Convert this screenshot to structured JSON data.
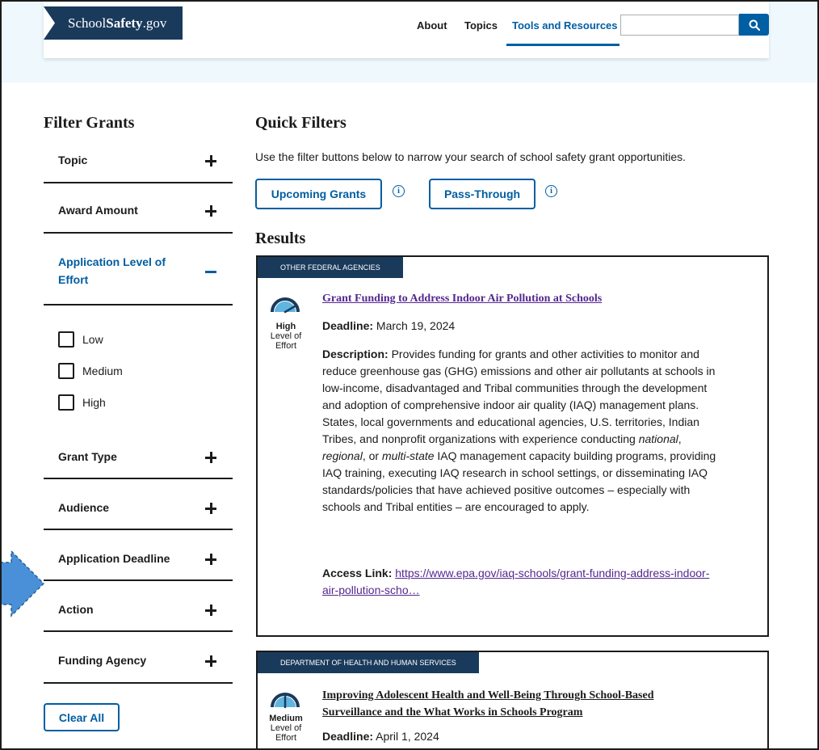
{
  "header": {
    "logo_regular": "School",
    "logo_bold": "Safety",
    "logo_suffix": ".gov",
    "nav": [
      {
        "label": "About"
      },
      {
        "label": "Topics"
      },
      {
        "label": "Tools and Resources"
      }
    ],
    "search_placeholder": ""
  },
  "sidebar": {
    "title": "Filter Grants",
    "items": [
      {
        "label": "Topic"
      },
      {
        "label": "Award Amount"
      },
      {
        "label": "Application Level of Effort"
      },
      {
        "label": "Grant Type"
      },
      {
        "label": "Audience"
      },
      {
        "label": "Application Deadline"
      },
      {
        "label": "Action"
      },
      {
        "label": "Funding Agency"
      }
    ],
    "effort_options": [
      {
        "label": "Low",
        "checked": false
      },
      {
        "label": "Medium",
        "checked": false
      },
      {
        "label": "High",
        "checked": false
      }
    ],
    "clear_label": "Clear All"
  },
  "main": {
    "quick_title": "Quick Filters",
    "intro": "Use the filter buttons below to narrow your search of school safety grant opportunities.",
    "quick_buttons": [
      {
        "label": "Upcoming Grants"
      },
      {
        "label": "Pass-Through"
      }
    ],
    "info_glyph": "i",
    "results_title": "Results",
    "results": [
      {
        "agency": "Other Federal Agencies",
        "effort_level": "High",
        "effort_caption_1": "Level of",
        "effort_caption_2": "Effort",
        "gauge_fraction": 1.0,
        "title": "Grant Funding to Address Indoor Air Pollution at Schools",
        "deadline_label": "Deadline:",
        "deadline": "March 19, 2024",
        "description_label": "Description:",
        "description_1": "Provides funding for grants and other activities to monitor and reduce greenhouse gas (GHG) emissions and other air pollutants at schools in low-income, disadvantaged and Tribal communities through the development and adoption of comprehensive indoor air quality (IAQ) management plans. States, local governments and educational agencies, U.S. territories, Indian Tribes, and nonprofit organizations with experience conducting ",
        "description_em_1": "national",
        "description_2": ", ",
        "description_em_2": "regional",
        "description_3": ", or ",
        "description_em_3": "multi-state",
        "description_4": " IAQ management capacity building programs, providing IAQ training, executing IAQ research in school settings, or disseminating IAQ standards/policies that have achieved positive outcomes – especially with schools and Tribal entities – are encouraged to apply.",
        "access_label": "Access Link:",
        "access_link": "https://www.epa.gov/iaq-schools/grant-funding-address-indoor-air-pollution-scho…"
      },
      {
        "agency": "Department of Health and Human Services",
        "effort_level": "Medium",
        "effort_caption_1": "Level of",
        "effort_caption_2": "Effort",
        "gauge_fraction": 0.5,
        "title": "Improving Adolescent Health and Well-Being Through School-Based Surveillance and the What Works in Schools Program",
        "deadline_label": "Deadline:",
        "deadline": "April 1, 2024"
      }
    ]
  },
  "colors": {
    "primary": "#005ea2",
    "navy": "#1a3a5c",
    "visited": "#54278f",
    "light_bg": "#eef8fd",
    "arrow": "#4a90d9"
  },
  "icons": {
    "search": "search-icon",
    "plus": "plus-icon",
    "minus": "minus-icon",
    "info": "info-icon",
    "gauge": "gauge-icon"
  }
}
